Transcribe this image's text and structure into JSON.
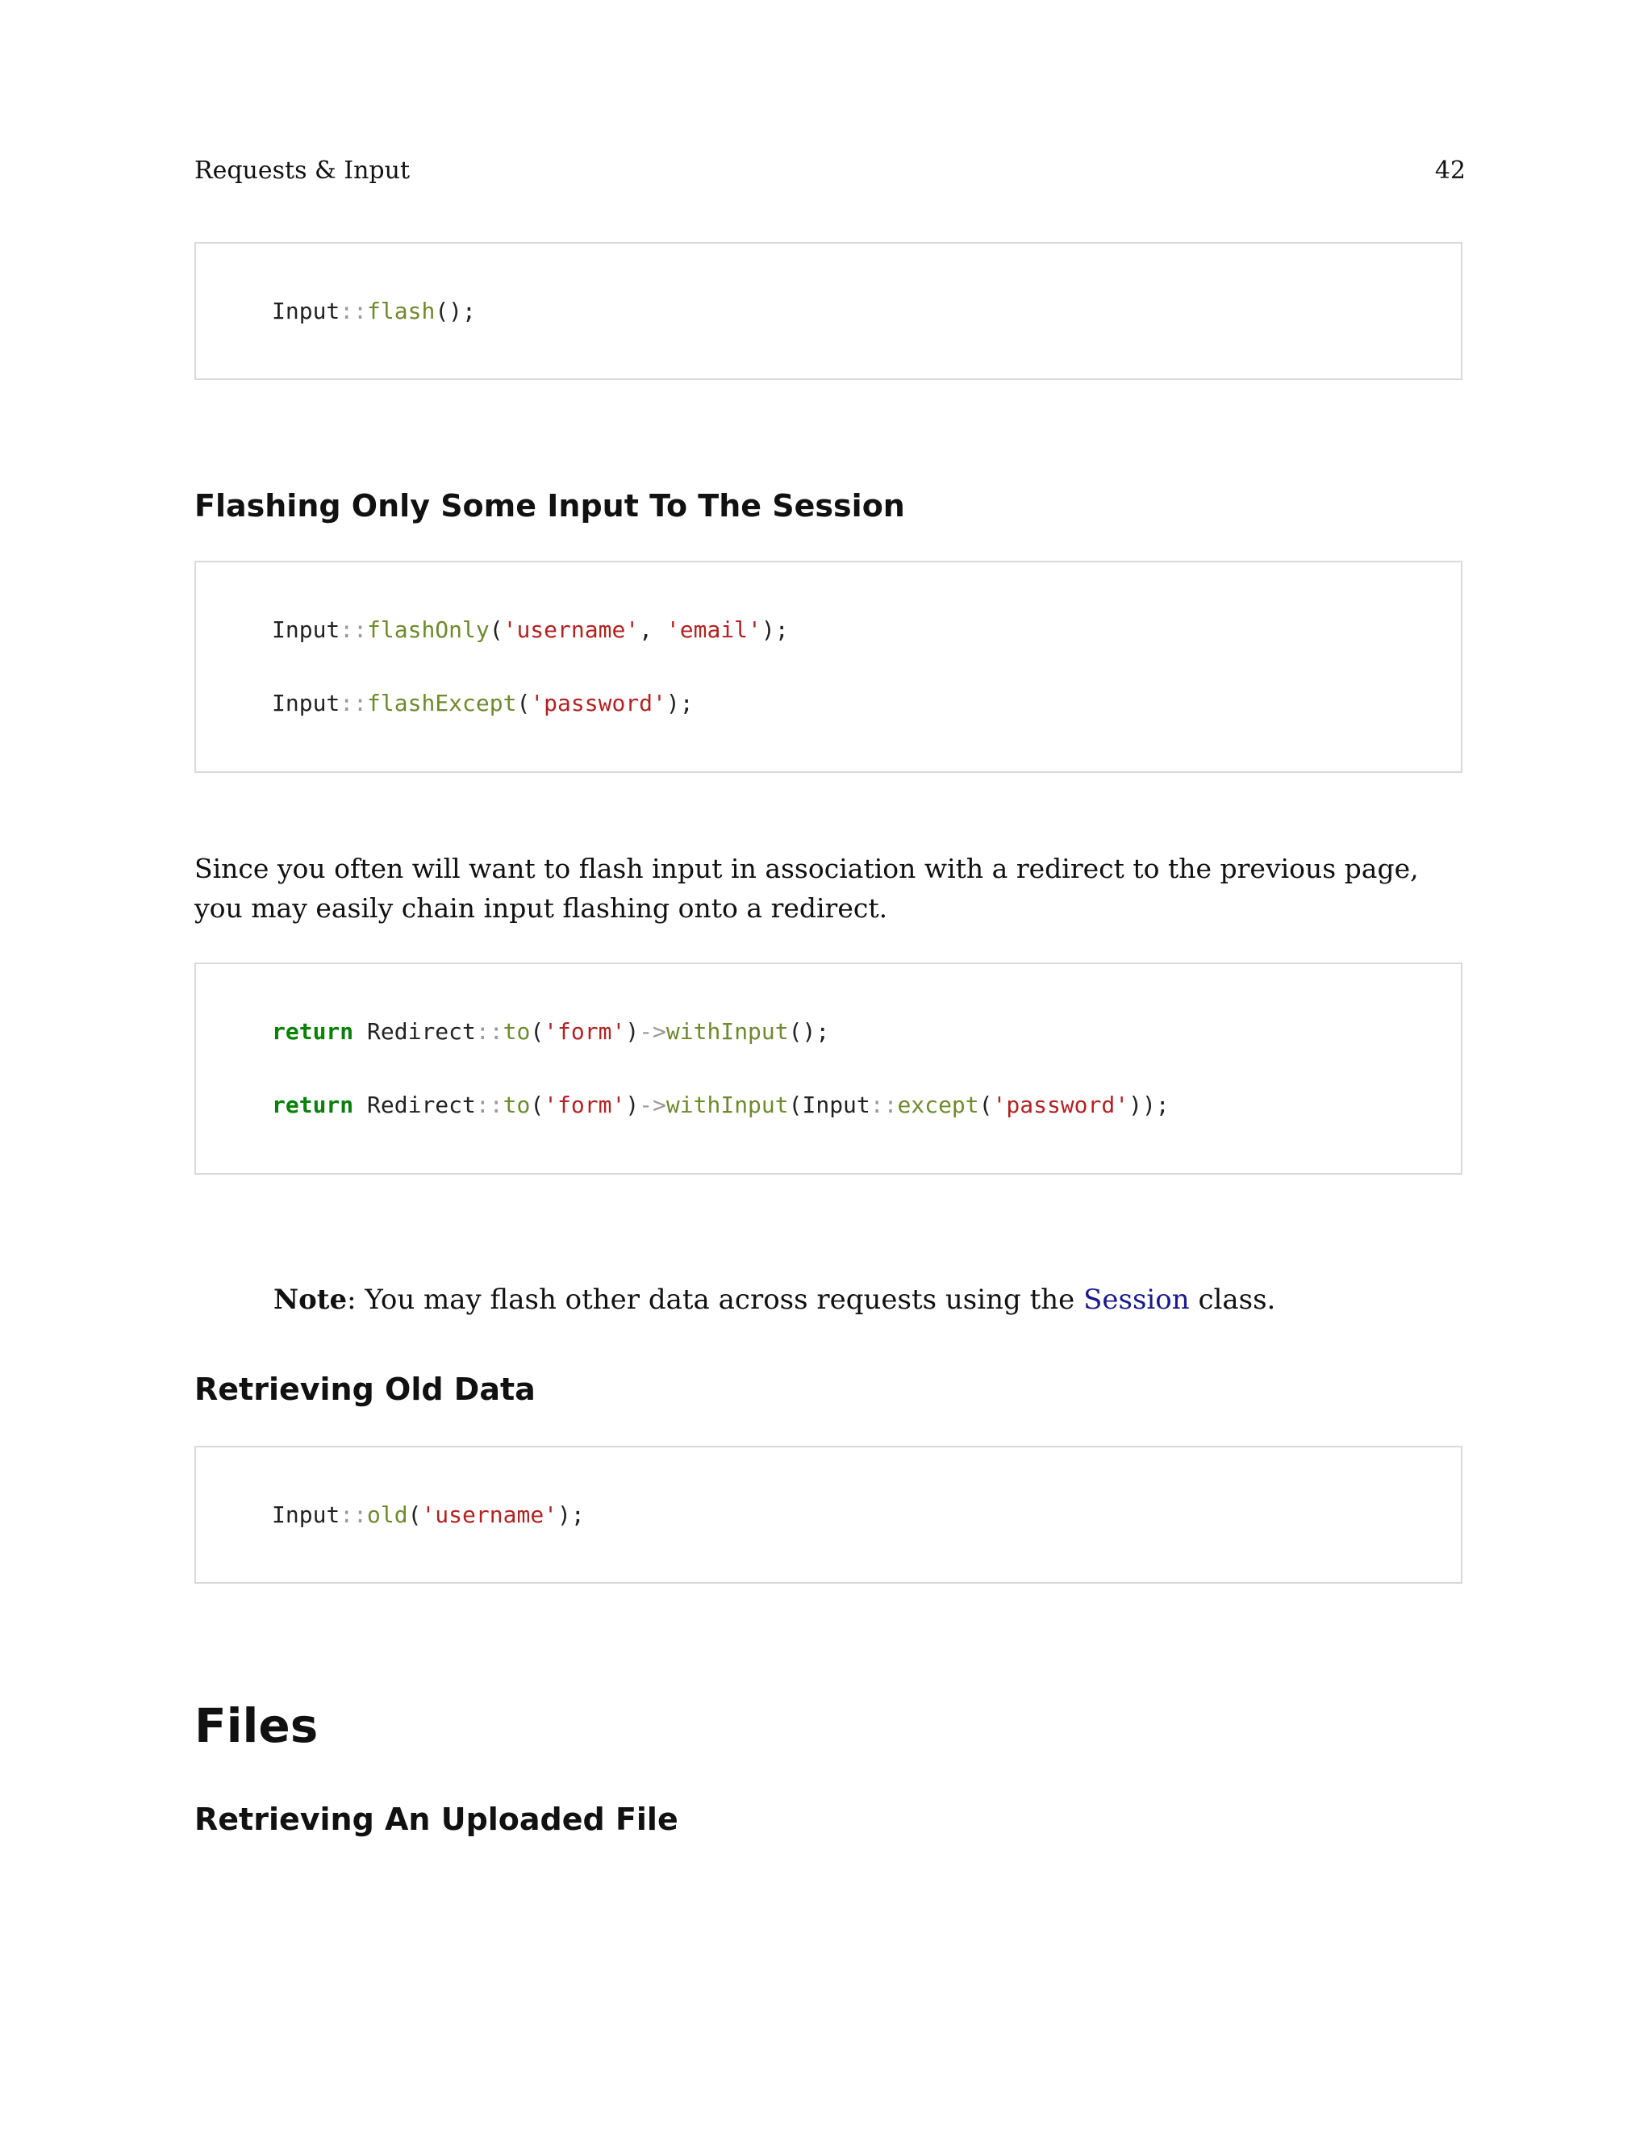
{
  "header": {
    "section_title": "Requests & Input",
    "page_number": "42"
  },
  "blocks": {
    "code1": {
      "lines": [
        [
          {
            "t": "Input",
            "c": "plain"
          },
          {
            "t": "::",
            "c": "op"
          },
          {
            "t": "flash",
            "c": "fn"
          },
          {
            "t": "();",
            "c": "plain"
          }
        ]
      ]
    },
    "heading1": "Flashing Only Some Input To The Session",
    "code2": {
      "lines": [
        [
          {
            "t": "Input",
            "c": "plain"
          },
          {
            "t": "::",
            "c": "op"
          },
          {
            "t": "flashOnly",
            "c": "fn"
          },
          {
            "t": "(",
            "c": "plain"
          },
          {
            "t": "'username'",
            "c": "str"
          },
          {
            "t": ", ",
            "c": "plain"
          },
          {
            "t": "'email'",
            "c": "str"
          },
          {
            "t": ");",
            "c": "plain"
          }
        ],
        [
          {
            "t": "Input",
            "c": "plain"
          },
          {
            "t": "::",
            "c": "op"
          },
          {
            "t": "flashExcept",
            "c": "fn"
          },
          {
            "t": "(",
            "c": "plain"
          },
          {
            "t": "'password'",
            "c": "str"
          },
          {
            "t": ");",
            "c": "plain"
          }
        ]
      ]
    },
    "paragraph1": "Since you often will want to flash input in association with a redirect to the previous page, you may easily chain input flashing onto a redirect.",
    "code3": {
      "lines": [
        [
          {
            "t": "return",
            "c": "kw"
          },
          {
            "t": " Redirect",
            "c": "plain"
          },
          {
            "t": "::",
            "c": "op"
          },
          {
            "t": "to",
            "c": "fn"
          },
          {
            "t": "(",
            "c": "plain"
          },
          {
            "t": "'form'",
            "c": "str"
          },
          {
            "t": ")",
            "c": "plain"
          },
          {
            "t": "->",
            "c": "op"
          },
          {
            "t": "withInput",
            "c": "fn"
          },
          {
            "t": "();",
            "c": "plain"
          }
        ],
        [
          {
            "t": "return",
            "c": "kw"
          },
          {
            "t": " Redirect",
            "c": "plain"
          },
          {
            "t": "::",
            "c": "op"
          },
          {
            "t": "to",
            "c": "fn"
          },
          {
            "t": "(",
            "c": "plain"
          },
          {
            "t": "'form'",
            "c": "str"
          },
          {
            "t": ")",
            "c": "plain"
          },
          {
            "t": "->",
            "c": "op"
          },
          {
            "t": "withInput",
            "c": "fn"
          },
          {
            "t": "(Input",
            "c": "plain"
          },
          {
            "t": "::",
            "c": "op"
          },
          {
            "t": "except",
            "c": "fn"
          },
          {
            "t": "(",
            "c": "plain"
          },
          {
            "t": "'password'",
            "c": "str"
          },
          {
            "t": "));",
            "c": "plain"
          }
        ]
      ]
    },
    "note": {
      "label": "Note",
      "text_before": ": You may flash other data across requests using the ",
      "link": "Session",
      "text_after": " class."
    },
    "heading2": "Retrieving Old Data",
    "code4": {
      "lines": [
        [
          {
            "t": "Input",
            "c": "plain"
          },
          {
            "t": "::",
            "c": "op"
          },
          {
            "t": "old",
            "c": "fn"
          },
          {
            "t": "(",
            "c": "plain"
          },
          {
            "t": "'username'",
            "c": "str"
          },
          {
            "t": ");",
            "c": "plain"
          }
        ]
      ]
    },
    "heading_files": "Files",
    "heading3": "Retrieving An Uploaded File"
  },
  "colors": {
    "keyword": "#098109",
    "operator": "#999999",
    "function": "#6e8a2e",
    "string": "#b22222",
    "link": "#1a1a8c",
    "code_border": "#d9d9d9"
  }
}
